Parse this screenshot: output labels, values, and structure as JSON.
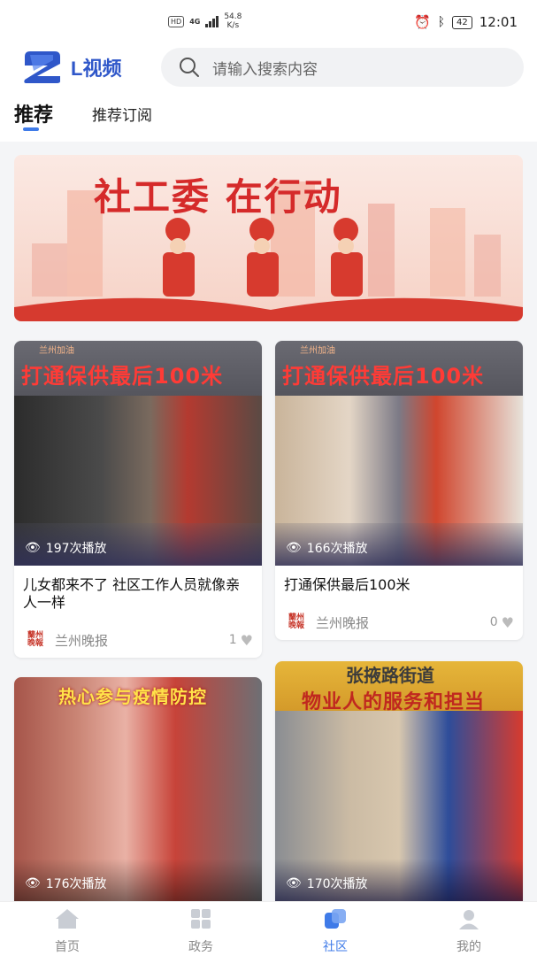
{
  "status_bar": {
    "hd": "HD",
    "network": "4G",
    "speed_value": "54.8",
    "speed_unit": "K/s",
    "battery": "42",
    "time": "12:01"
  },
  "header": {
    "logo_text": "L视频",
    "search_placeholder": "请输入搜索内容"
  },
  "tabs": {
    "active": "推荐",
    "other": "推荐订阅"
  },
  "banner": {
    "title": "社工委 在行动"
  },
  "cards": [
    {
      "kicker": "兰州加油",
      "headline": "打通保供最后100米",
      "plays": "197次播放",
      "title": "儿女都来不了 社区工作人员就像亲人一样",
      "source": "兰州晚报",
      "likes": "1"
    },
    {
      "kicker": "兰州加油",
      "headline": "打通保供最后100米",
      "plays": "166次播放",
      "title": "打通保供最后100米",
      "source": "兰州晚报",
      "likes": "0"
    },
    {
      "headline": "热心参与疫情防控",
      "plays": "176次播放"
    },
    {
      "headline": "物业人的服务和担当",
      "kicker": "张掖路街道",
      "plays": "170次播放"
    }
  ],
  "bottom_nav": {
    "items": [
      {
        "label": "首页",
        "icon": "home-icon"
      },
      {
        "label": "政务",
        "icon": "grid-icon"
      },
      {
        "label": "社区",
        "icon": "community-icon"
      },
      {
        "label": "我的",
        "icon": "user-icon"
      }
    ],
    "active_index": 2
  },
  "colors": {
    "accent": "#3f7be8",
    "brand": "#2f57c9",
    "headline_red": "#ff3b36"
  }
}
